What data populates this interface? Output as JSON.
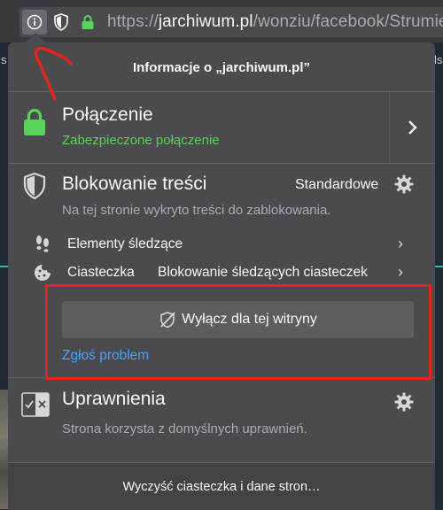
{
  "browser": {
    "url_prefix": "https://",
    "url_domain": "jarchiwum.pl",
    "url_path": "/wonziu/facebook/Strumie",
    "icons": [
      "info-icon",
      "tracking-shield-icon",
      "lock-icon"
    ]
  },
  "panel": {
    "title": "Informacje o „jarchiwum.pl”",
    "connection": {
      "title": "Połączenie",
      "status": "Zabezpieczone połączenie"
    },
    "content_blocking": {
      "title": "Blokowanie treści",
      "mode": "Standardowe",
      "description": "Na tej stronie wykryto treści do zablokowania.",
      "rows": [
        {
          "label": "Elementy śledzące",
          "value": ""
        },
        {
          "label": "Ciasteczka",
          "value": "Blokowanie śledzących ciasteczek"
        }
      ],
      "disable_button": "Wyłącz dla tej witryny",
      "report_link": "Zgłoś problem"
    },
    "permissions": {
      "title": "Uprawnienia",
      "description": "Strona korzysta z domyślnych uprawnień."
    },
    "footer_button": "Wyczyść ciasteczka i dane stron…"
  },
  "background": {
    "left_mark": "s",
    "right_mark": "ls"
  },
  "colors": {
    "green": "#57d157",
    "link": "#45a1ff",
    "annotation_red": "#e3241b"
  }
}
